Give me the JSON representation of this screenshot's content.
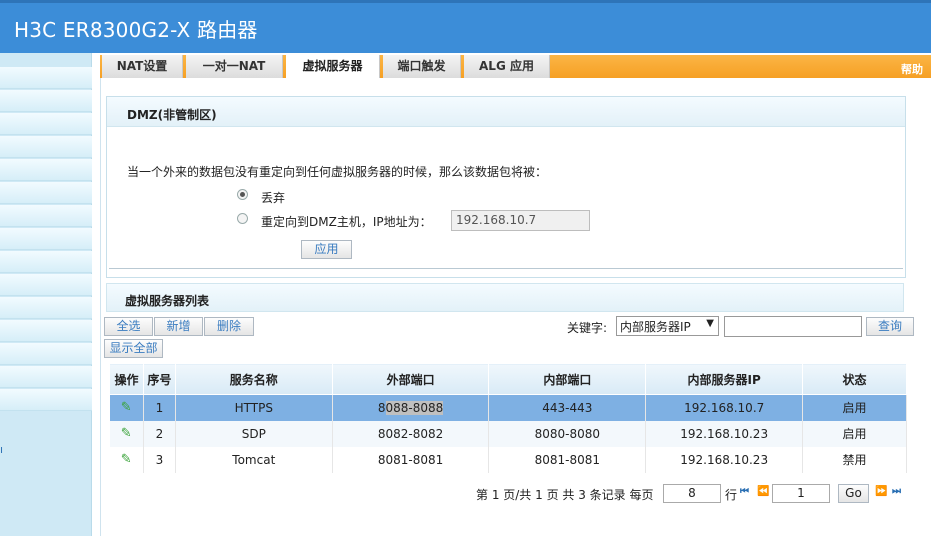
{
  "app": {
    "title": "H3C ER8300G2-X 路由器"
  },
  "tabs": [
    {
      "label": "NAT设置"
    },
    {
      "label": "一对一NAT"
    },
    {
      "label": "虚拟服务器",
      "active": true
    },
    {
      "label": "端口触发"
    },
    {
      "label": "ALG 应用"
    }
  ],
  "help": "帮助",
  "dmz": {
    "title": "DMZ(非管制区)",
    "description": "当一个外来的数据包没有重定向到任何虚拟服务器的时候，那么该数据包将被：",
    "option_discard": "丢弃",
    "option_redirect": "重定向到DMZ主机，IP地址为：",
    "selected": "discard",
    "ip_value": "192.168.10.7",
    "apply": "应用"
  },
  "list": {
    "title": "虚拟服务器列表",
    "select_all": "全选",
    "add": "新增",
    "delete": "删除",
    "show_all": "显示全部",
    "keyword_label": "关键字:",
    "keyword_field": "内部服务器IP",
    "keyword_value": "",
    "search": "查询",
    "columns": [
      "操作",
      "序号",
      "服务名称",
      "外部端口",
      "内部端口",
      "内部服务器IP",
      "状态"
    ],
    "rows": [
      {
        "no": "1",
        "name": "HTTPS",
        "ext_pre": "8",
        "ext_hl": "088-8088",
        "int": "443-443",
        "ip": "192.168.10.7",
        "status": "启用"
      },
      {
        "no": "2",
        "name": "SDP",
        "ext": "8082-8082",
        "int": "8080-8080",
        "ip": "192.168.10.23",
        "status": "启用"
      },
      {
        "no": "3",
        "name": "Tomcat",
        "ext": "8081-8081",
        "int": "8081-8081",
        "ip": "192.168.10.23",
        "status": "禁用"
      }
    ]
  },
  "pager": {
    "summary": "第 1 页/共 1 页 共 3 条记录 每页",
    "per_page": "8",
    "row_label": "行",
    "page": "1",
    "go": "Go"
  },
  "sidebar": {
    "link_char": "ı"
  },
  "colors": {
    "header": "#3c8dd8",
    "tabbar": "#f6a024",
    "selected_row": "#7eb0e3"
  }
}
